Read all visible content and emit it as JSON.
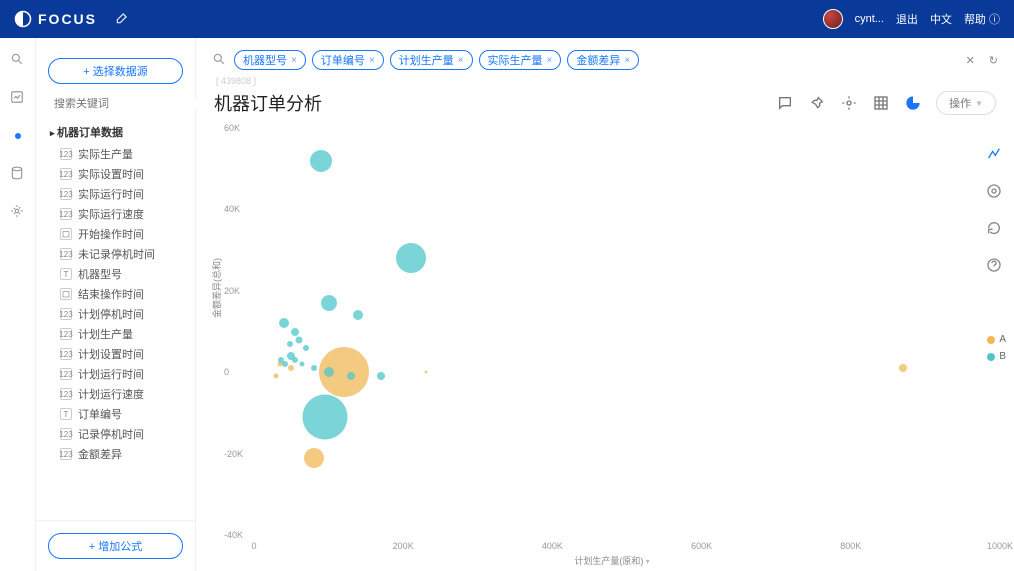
{
  "app": {
    "name": "FOCUS"
  },
  "topbar": {
    "user": "cynt...",
    "logout": "退出",
    "lang": "中文",
    "help": "帮助"
  },
  "sidebar": {
    "select_source": "+ 选择数据源",
    "search_placeholder": "搜索关键词",
    "root": "机器订单数据",
    "items": [
      {
        "icon": "num",
        "label": "实际生产量"
      },
      {
        "icon": "num",
        "label": "实际设置时间"
      },
      {
        "icon": "num",
        "label": "实际运行时间"
      },
      {
        "icon": "num",
        "label": "实际运行速度"
      },
      {
        "icon": "date",
        "label": "开始操作时间"
      },
      {
        "icon": "num",
        "label": "未记录停机时间"
      },
      {
        "icon": "text",
        "label": "机器型号"
      },
      {
        "icon": "date",
        "label": "结束操作时间"
      },
      {
        "icon": "num",
        "label": "计划停机时间"
      },
      {
        "icon": "num",
        "label": "计划生产量"
      },
      {
        "icon": "num",
        "label": "计划设置时间"
      },
      {
        "icon": "num",
        "label": "计划运行时间"
      },
      {
        "icon": "num",
        "label": "计划运行速度"
      },
      {
        "icon": "text",
        "label": "订单编号"
      },
      {
        "icon": "num",
        "label": "记录停机时间"
      },
      {
        "icon": "num",
        "label": "金额差异"
      }
    ],
    "add_formula": "+ 增加公式"
  },
  "query": {
    "chips": [
      "机器型号",
      "订单编号",
      "计划生产量",
      "实际生产量",
      "金额差异"
    ],
    "breadcrumb": "[ 439808 ]"
  },
  "page": {
    "title": "机器订单分析",
    "operate": "操作"
  },
  "legend": {
    "A": "A",
    "B": "B"
  },
  "chart_data": {
    "type": "scatter",
    "xlabel": "计划生产量(原和)",
    "ylabel": "金额差异(总和)",
    "xlim": [
      0,
      1000000
    ],
    "ylim": [
      -40000,
      60000
    ],
    "xticks": [
      0,
      200000,
      400000,
      600000,
      800000,
      1000000
    ],
    "xtick_labels": [
      "0",
      "200K",
      "400K",
      "600K",
      "800K",
      "1000K"
    ],
    "yticks": [
      -40000,
      -20000,
      0,
      20000,
      40000,
      60000
    ],
    "ytick_labels": [
      "-40K",
      "-20K",
      "0",
      "20K",
      "40K",
      "60K"
    ],
    "series": [
      {
        "name": "A",
        "color": "#f0b856",
        "points": [
          {
            "x": 120000,
            "y": 0,
            "size": 50
          },
          {
            "x": 80000,
            "y": -21000,
            "size": 20
          },
          {
            "x": 230000,
            "y": 0,
            "size": 3
          },
          {
            "x": 50000,
            "y": 1000,
            "size": 6
          },
          {
            "x": 30000,
            "y": -1000,
            "size": 5
          },
          {
            "x": 35000,
            "y": 2000,
            "size": 5
          },
          {
            "x": 870000,
            "y": 1000,
            "size": 8
          }
        ]
      },
      {
        "name": "B",
        "color": "#4fc5c9",
        "points": [
          {
            "x": 90000,
            "y": 52000,
            "size": 22
          },
          {
            "x": 210000,
            "y": 28000,
            "size": 30
          },
          {
            "x": 100000,
            "y": 17000,
            "size": 16
          },
          {
            "x": 140000,
            "y": 14000,
            "size": 10
          },
          {
            "x": 40000,
            "y": 12000,
            "size": 10
          },
          {
            "x": 55000,
            "y": 10000,
            "size": 8
          },
          {
            "x": 60000,
            "y": 8000,
            "size": 7
          },
          {
            "x": 48000,
            "y": 7000,
            "size": 6
          },
          {
            "x": 70000,
            "y": 6000,
            "size": 6
          },
          {
            "x": 50000,
            "y": 4000,
            "size": 8
          },
          {
            "x": 36000,
            "y": 3000,
            "size": 6
          },
          {
            "x": 55000,
            "y": 3000,
            "size": 6
          },
          {
            "x": 42000,
            "y": 2000,
            "size": 6
          },
          {
            "x": 65000,
            "y": 2000,
            "size": 5
          },
          {
            "x": 80000,
            "y": 1000,
            "size": 6
          },
          {
            "x": 100000,
            "y": 0,
            "size": 10
          },
          {
            "x": 130000,
            "y": -1000,
            "size": 8
          },
          {
            "x": 170000,
            "y": -1000,
            "size": 8
          },
          {
            "x": 95000,
            "y": -11000,
            "size": 45
          }
        ]
      }
    ]
  }
}
